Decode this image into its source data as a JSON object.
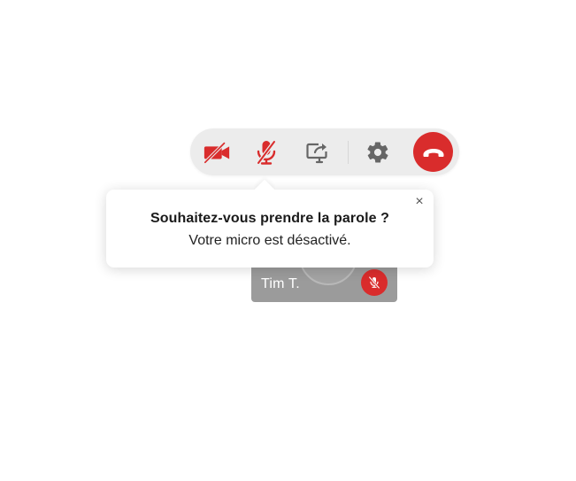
{
  "toolbar": {
    "buttons": [
      {
        "icon": "video-off-icon",
        "color": "#d92c2c"
      },
      {
        "icon": "microphone-off-icon",
        "color": "#d92c2c"
      },
      {
        "icon": "screen-share-icon",
        "color": "#666666"
      },
      {
        "icon": "gear-icon",
        "color": "#666666"
      },
      {
        "icon": "hang-up-icon",
        "color": "#d92c2c"
      }
    ]
  },
  "popover": {
    "title": "Souhaitez-vous prendre la parole ?",
    "message": "Votre micro est désactivé.",
    "close_label": "×"
  },
  "participant": {
    "name": "Tim T.",
    "muted_icon": "microphone-off-icon"
  },
  "colors": {
    "accent_red": "#d92c2c",
    "toolbar_bg": "#ececec",
    "tile_bg": "#9b9b9b"
  }
}
